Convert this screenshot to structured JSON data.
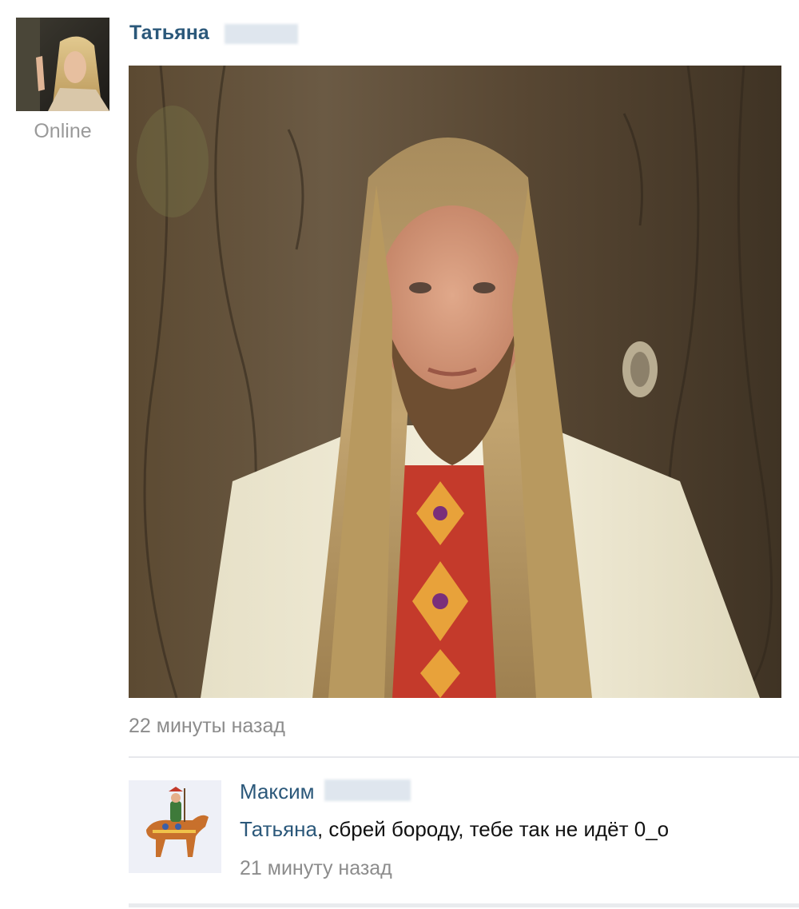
{
  "post": {
    "author_name": "Татьяна",
    "author_status": "Online",
    "time": "22 минуты назад"
  },
  "comment": {
    "author_name": "Максим",
    "mention": "Татьяна",
    "text": ", сбрей бороду, тебе так не идёт 0_о",
    "time": "21 минуту назад"
  },
  "colors": {
    "link": "#2b587a",
    "muted": "#8c8c8c",
    "divider": "#e7e8ec"
  }
}
